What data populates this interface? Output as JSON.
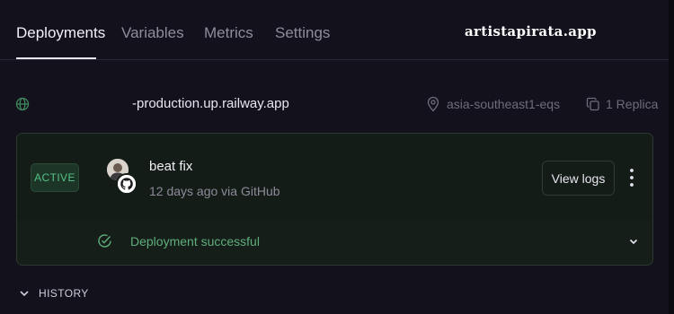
{
  "brand": "artistapirata.app",
  "tabs": [
    {
      "label": "Deployments",
      "active": true
    },
    {
      "label": "Variables",
      "active": false
    },
    {
      "label": "Metrics",
      "active": false
    },
    {
      "label": "Settings",
      "active": false
    }
  ],
  "service": {
    "domain": "-production.up.railway.app",
    "region": "asia-southeast1-eqs",
    "replicas": "1 Replica"
  },
  "deployment": {
    "status": "ACTIVE",
    "commit_message": "beat fix",
    "meta": "12 days ago via GitHub",
    "view_logs_label": "View logs",
    "footer_message": "Deployment successful"
  },
  "history": {
    "label": "HISTORY"
  },
  "colors": {
    "background": "#13111c",
    "active_green": "#54c184",
    "success_green": "#5fae7c"
  },
  "icons": {
    "domain": "globe-icon",
    "region": "map-pin-icon",
    "replicas": "copy-icon",
    "source": "github-icon",
    "success": "check-circle-icon",
    "expand": "chevron-down-icon",
    "menu": "more-vertical-icon"
  }
}
